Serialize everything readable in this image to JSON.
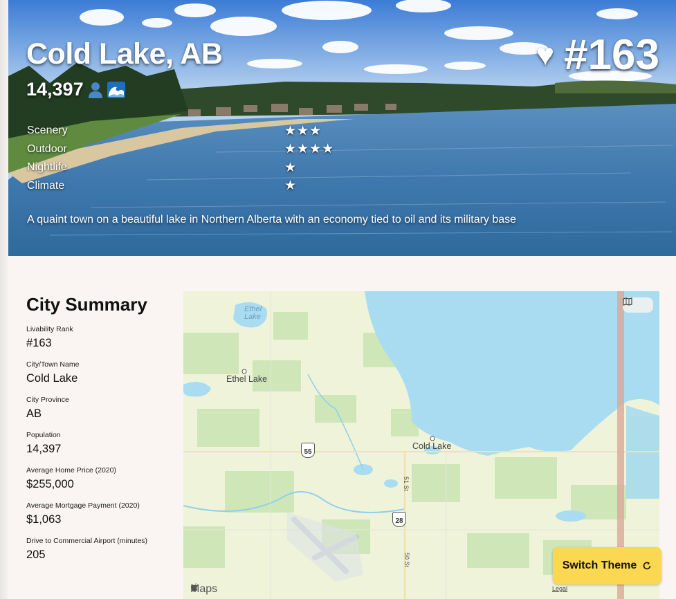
{
  "hero": {
    "title": "Cold Lake, AB",
    "population": "14,397",
    "population_icons": [
      "person-icon",
      "wave-icon"
    ],
    "rank": "#163",
    "rank_icon": "heart-icon",
    "description": "A quaint town on a beautiful lake in Northern Alberta with an economy tied to oil and its military base",
    "ratings": [
      {
        "label": "Scenery",
        "stars": "★★★",
        "value": 3
      },
      {
        "label": "Outdoor",
        "stars": "★★★★",
        "value": 4
      },
      {
        "label": "Nightlife",
        "stars": "★",
        "value": 1
      },
      {
        "label": "Climate",
        "stars": "★",
        "value": 1
      }
    ]
  },
  "summary": {
    "heading": "City Summary",
    "fields": [
      {
        "label": "Livability Rank",
        "value": "#163"
      },
      {
        "label": "City/Town Name",
        "value": "Cold Lake"
      },
      {
        "label": "City Province",
        "value": "AB"
      },
      {
        "label": "Population",
        "value": "14,397"
      },
      {
        "label": "Average Home Price (2020)",
        "value": "$255,000"
      },
      {
        "label": "Average Mortgage Payment (2020)",
        "value": "$1,063"
      },
      {
        "label": "Drive to Commercial Airport (minutes)",
        "value": "205"
      }
    ]
  },
  "map": {
    "lake_label": "Ethel\nLake",
    "places": [
      "Ethel Lake",
      "Cold Lake"
    ],
    "highways": [
      "55",
      "28"
    ],
    "streets": [
      "51 St",
      "50 St"
    ],
    "brand": "Maps",
    "legal": "Legal",
    "map_toggle_icon": "map-icon"
  },
  "theme_button": {
    "label": "Switch Theme",
    "icon": "refresh-icon"
  },
  "colors": {
    "accent": "#fbd752",
    "background": "#faf5f2",
    "water": "#a9dcf0",
    "land": "#eef3da"
  }
}
